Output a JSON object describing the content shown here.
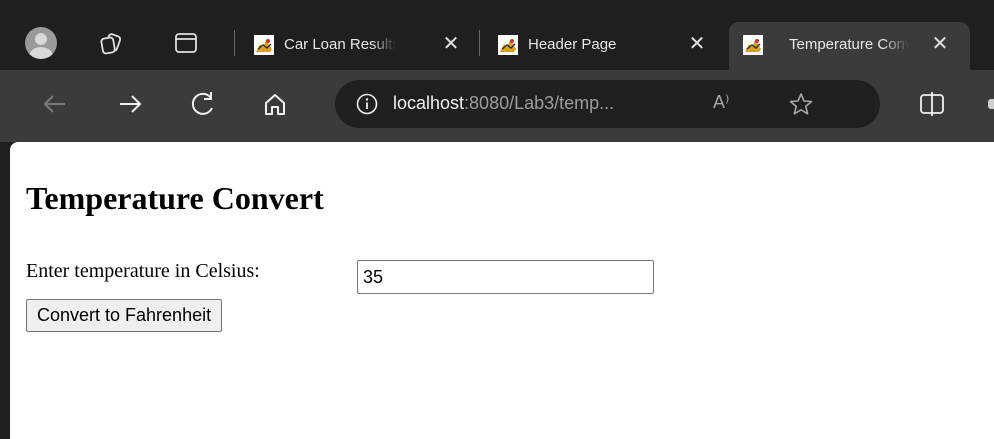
{
  "tabs": [
    {
      "title": "Car Loan Results",
      "close": "✕",
      "active": false
    },
    {
      "title": "Header Page",
      "close": "✕",
      "active": false
    },
    {
      "title": "Temperature Convert",
      "close": "✕",
      "active": true
    }
  ],
  "address_bar": {
    "host": "localhost",
    "path": ":8080/Lab3/temp...",
    "read_aloud": "A⁾"
  },
  "icons": {
    "profile": "profile-avatar-icon",
    "workspaces": "workspaces-icon",
    "tab_actions": "tab-actions-icon",
    "back": "back-arrow-icon",
    "forward": "forward-arrow-icon",
    "refresh": "refresh-icon",
    "home": "home-icon",
    "site_info": "info-icon",
    "read_aloud": "read-aloud-icon",
    "favorite": "star-icon",
    "split_screen": "split-screen-icon",
    "favicon": "tomcat-favicon-icon"
  },
  "page": {
    "heading": "Temperature Convert",
    "label": "Enter temperature in Celsius:",
    "input_value": "35",
    "button_label": "Convert to Fahrenheit"
  },
  "colors": {
    "tabstrip": "#1f1f1f",
    "toolbar": "#3b3b3b",
    "page_bg": "#ffffff"
  }
}
